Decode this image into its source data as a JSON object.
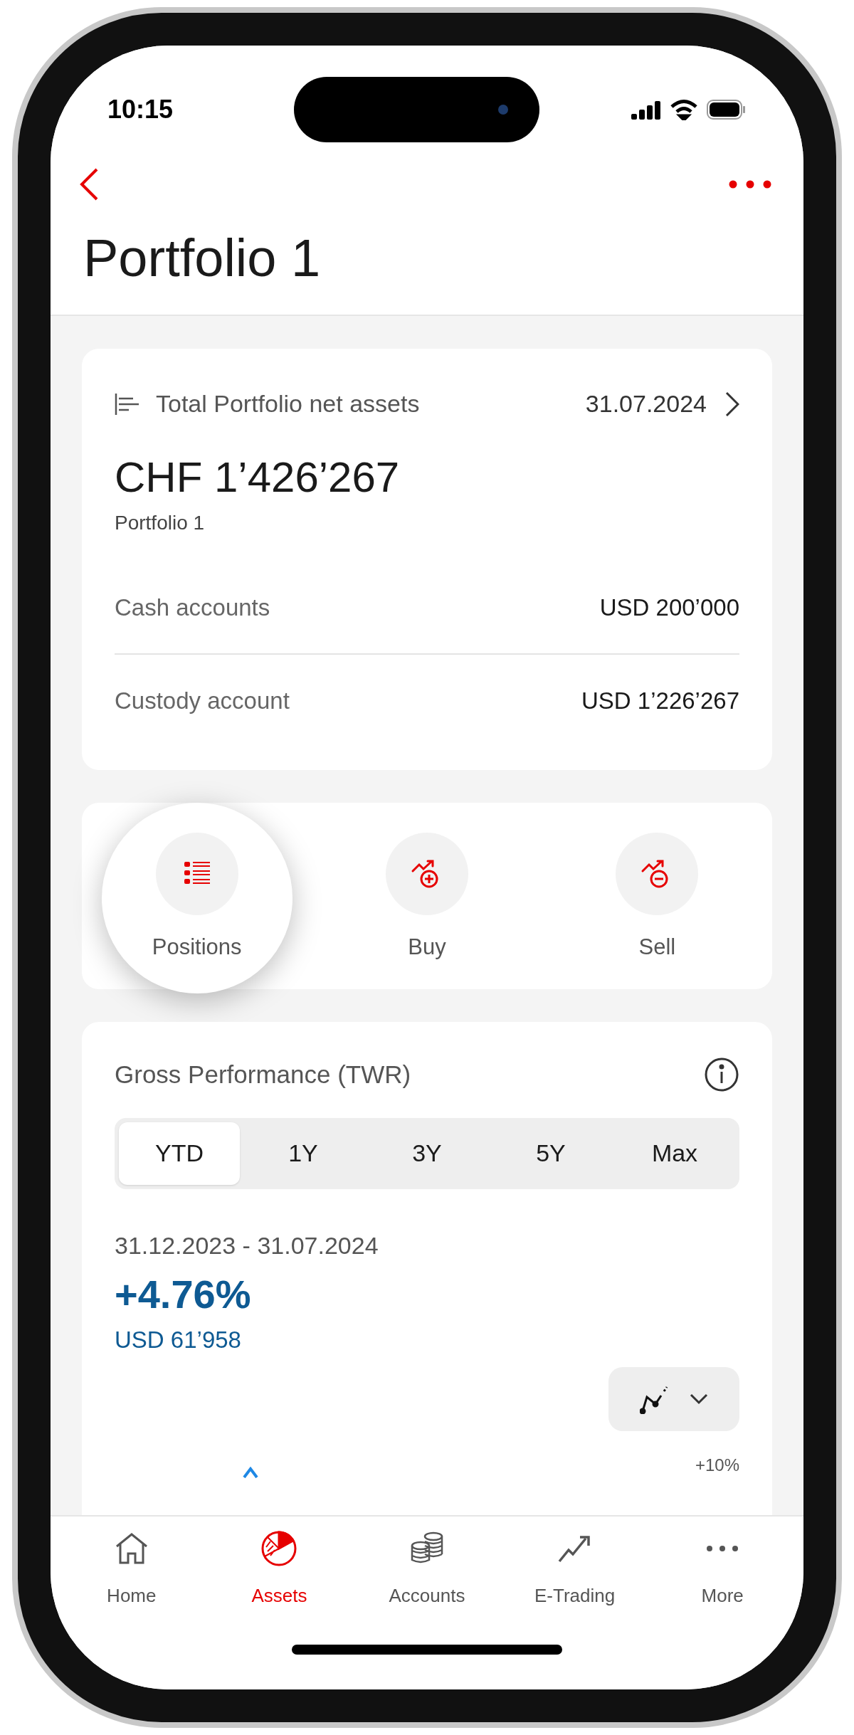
{
  "status_bar": {
    "time": "10:15"
  },
  "header": {
    "title": "Portfolio 1"
  },
  "summary": {
    "label": "Total Portfolio net assets",
    "date": "31.07.2024",
    "total": "CHF 1’426’267",
    "subtitle": "Portfolio 1",
    "rows": [
      {
        "label": "Cash accounts",
        "value": "USD 200’000"
      },
      {
        "label": "Custody account",
        "value": "USD 1’226’267"
      }
    ]
  },
  "actions": [
    {
      "label": "Positions",
      "kind": "positions",
      "highlighted": true
    },
    {
      "label": "Buy",
      "kind": "buy",
      "highlighted": false
    },
    {
      "label": "Sell",
      "kind": "sell",
      "highlighted": false
    }
  ],
  "performance": {
    "title": "Gross Performance (TWR)",
    "periods": [
      {
        "label": "YTD",
        "selected": true
      },
      {
        "label": "1Y",
        "selected": false
      },
      {
        "label": "3Y",
        "selected": false
      },
      {
        "label": "5Y",
        "selected": false
      },
      {
        "label": "Max",
        "selected": false
      }
    ],
    "range": "31.12.2023 - 31.07.2024",
    "percent": "+4.76%",
    "amount": "USD 61’958",
    "axis_label": "+10%"
  },
  "tab_bar": [
    {
      "label": "Home",
      "kind": "home",
      "selected": false
    },
    {
      "label": "Assets",
      "kind": "assets",
      "selected": true
    },
    {
      "label": "Accounts",
      "kind": "accounts",
      "selected": false
    },
    {
      "label": "E-Trading",
      "kind": "trading",
      "selected": false
    },
    {
      "label": "More",
      "kind": "more",
      "selected": false
    }
  ]
}
